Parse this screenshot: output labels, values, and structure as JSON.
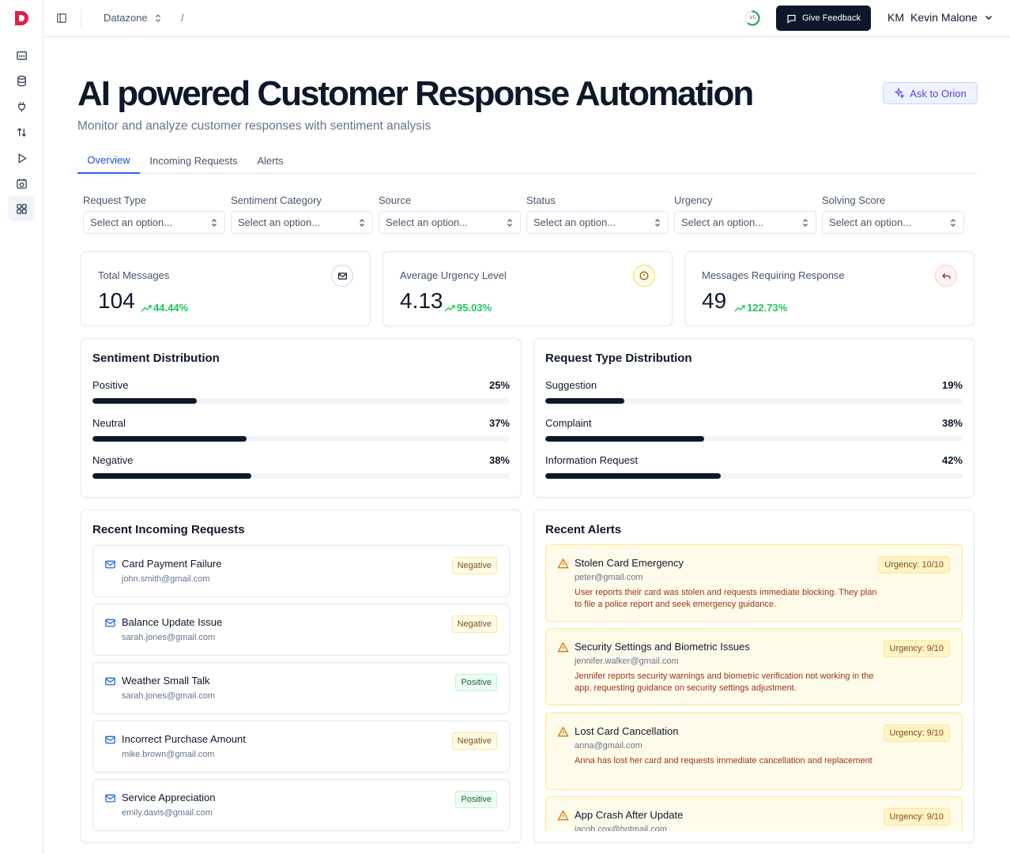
{
  "topbar": {
    "workspace": "Datazone",
    "crumb_separator": "/",
    "progress_text": "3/5",
    "progress_value": 0.6,
    "feedback_label": "Give Feedback",
    "user_initials": "KM",
    "user_name": "Kevin Malone"
  },
  "header": {
    "title": "AI powered Customer Response Automation",
    "subtitle": "Monitor and analyze customer responses with sentiment analysis",
    "ask_label": "Ask to Orion"
  },
  "tabs": [
    {
      "label": "Overview",
      "active": true
    },
    {
      "label": "Incoming Requests",
      "active": false
    },
    {
      "label": "Alerts",
      "active": false
    }
  ],
  "filters": [
    {
      "label": "Request Type",
      "placeholder": "Select an option..."
    },
    {
      "label": "Sentiment Category",
      "placeholder": "Select an option..."
    },
    {
      "label": "Source",
      "placeholder": "Select an option..."
    },
    {
      "label": "Status",
      "placeholder": "Select an option..."
    },
    {
      "label": "Urgency",
      "placeholder": "Select an option..."
    },
    {
      "label": "Solving Score",
      "placeholder": "Select an option..."
    }
  ],
  "stats": [
    {
      "label": "Total Messages",
      "value": "104",
      "change": "44.44%",
      "icon": "mail-icon"
    },
    {
      "label": "Average Urgency Level",
      "value": "4.13",
      "change": "95.03%",
      "icon": "alert-circle-icon"
    },
    {
      "label": "Messages Requiring Response",
      "value": "49",
      "change": "122.73%",
      "icon": "reply-icon"
    }
  ],
  "sentiment": {
    "title": "Sentiment Distribution",
    "rows": [
      {
        "label": "Positive",
        "pct": "25%",
        "value": 25
      },
      {
        "label": "Neutral",
        "pct": "37%",
        "value": 37
      },
      {
        "label": "Negative",
        "pct": "38%",
        "value": 38
      }
    ]
  },
  "request_types": {
    "title": "Request Type Distribution",
    "rows": [
      {
        "label": "Suggestion",
        "pct": "19%",
        "value": 19
      },
      {
        "label": "Complaint",
        "pct": "38%",
        "value": 38
      },
      {
        "label": "Information Request",
        "pct": "42%",
        "value": 42
      }
    ]
  },
  "recent_requests": {
    "title": "Recent Incoming Requests",
    "items": [
      {
        "title": "Card Payment Failure",
        "email": "john.smith@gmail.com",
        "sentiment": "Negative"
      },
      {
        "title": "Balance Update Issue",
        "email": "sarah.jones@gmail.com",
        "sentiment": "Negative"
      },
      {
        "title": "Weather Small Talk",
        "email": "sarah.jones@gmail.com",
        "sentiment": "Positive"
      },
      {
        "title": "Incorrect Purchase Amount",
        "email": "mike.brown@gmail.com",
        "sentiment": "Negative"
      },
      {
        "title": "Service Appreciation",
        "email": "emily.davis@gmail.com",
        "sentiment": "Positive"
      }
    ]
  },
  "recent_alerts": {
    "title": "Recent Alerts",
    "items": [
      {
        "title": "Stolen Card Emergency",
        "email": "peter@gmail.com",
        "urgency": "Urgency: 10/10",
        "desc": "User reports their card was stolen and requests immediate blocking. They plan to file a police report and seek emergency guidance."
      },
      {
        "title": "Security Settings and Biometric Issues",
        "email": "jennifer.walker@gmail.com",
        "urgency": "Urgency: 9/10",
        "desc": "Jennifer reports security warnings and biometric verification not working in the app, requesting guidance on security settings adjustment."
      },
      {
        "title": "Lost Card Cancellation",
        "email": "anna@gmail.com",
        "urgency": "Urgency: 9/10",
        "desc": "Anna has lost her card and requests immediate cancellation and replacement"
      },
      {
        "title": "App Crash After Update",
        "email": "jacob.cox@hotmail.com",
        "urgency": "Urgency: 9/10",
        "desc": ""
      }
    ]
  },
  "colors": {
    "accent": "#2563eb",
    "positive": "#22c55e",
    "bar": "#0f172a",
    "brand": "#e11d48"
  }
}
